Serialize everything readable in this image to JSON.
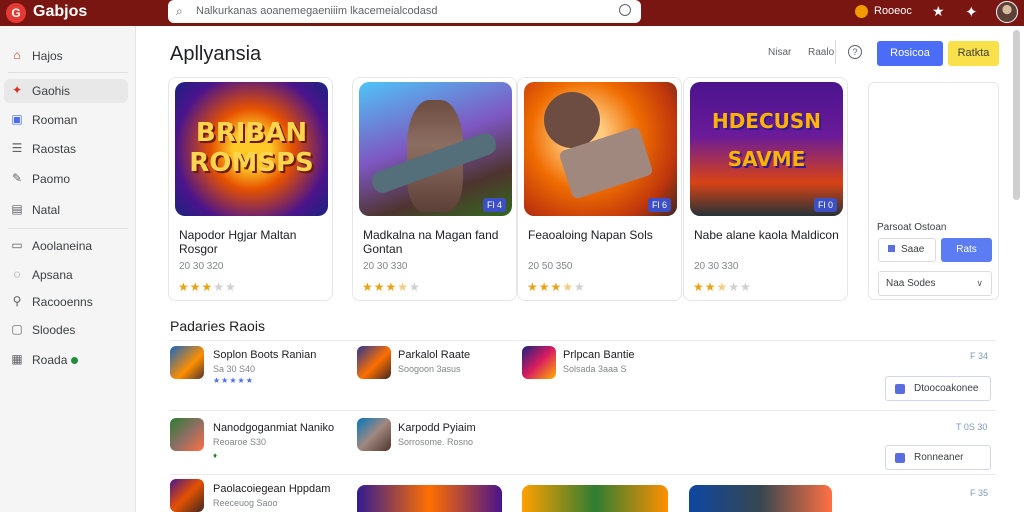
{
  "app": {
    "title": "Gabjos",
    "logo_glyph": "G"
  },
  "search": {
    "value": "Nalkurkanas aoanemegaeniiim lkacemeialcodasd"
  },
  "topbar": {
    "user_label": "Rooeoc"
  },
  "sidebar": {
    "items": [
      {
        "label": "Hajos",
        "icon": "home-icon",
        "glyph": "⌂"
      },
      {
        "label": "Gaohis",
        "icon": "games-icon",
        "glyph": "✦"
      },
      {
        "label": "Rooman",
        "icon": "apps-icon",
        "glyph": "▣"
      },
      {
        "label": "Raostas",
        "icon": "list-icon",
        "glyph": "☰"
      },
      {
        "label": "Paomo",
        "icon": "edit-icon",
        "glyph": "✎"
      },
      {
        "label": "Natal",
        "icon": "book-icon",
        "glyph": "▤"
      },
      {
        "label": "Aoolaneina",
        "icon": "library-icon",
        "glyph": "▭"
      },
      {
        "label": "Apsana",
        "icon": "chat-icon",
        "glyph": "◌"
      },
      {
        "label": "Racooenns",
        "icon": "lock-icon",
        "glyph": "⚲"
      },
      {
        "label": "Sloodes",
        "icon": "folder-icon",
        "glyph": "▢"
      },
      {
        "label": "Roada",
        "icon": "notice-icon",
        "glyph": "▦"
      }
    ]
  },
  "header": {
    "title": "Apllyansia",
    "links": [
      "Nisar",
      "Raalo"
    ],
    "help": "?",
    "primary_button": "Rosicoa",
    "secondary_button": "Ratkta"
  },
  "featured": [
    {
      "title": "Napodor Hgjar Maltan Rosgor",
      "meta": "20 30 320",
      "rating": 3,
      "art_text": "BRIBAN ROMSPS",
      "badge": ""
    },
    {
      "title": "Madkalna na Magan fand Gontan",
      "meta": "20 30 330",
      "rating": 3.5,
      "art_text": "",
      "badge": "Fl 4"
    },
    {
      "title": "Feaoaloing Napan Sols",
      "meta": "20 50 350",
      "rating": 3.5,
      "art_text": "",
      "badge": "Fl 6"
    },
    {
      "title": "Nabe alane kaola Maldicon",
      "meta": "20 30 330",
      "rating": 2.5,
      "art_text": "HDECUSN SAVME",
      "badge": "Fl 0"
    }
  ],
  "panel": {
    "label": "Parsoat Ostoan",
    "btn_secondary": "Saae",
    "btn_primary": "Rats",
    "select_value": "Naa Sodes"
  },
  "list": {
    "title": "Padaries Raois",
    "rows": [
      {
        "items": [
          {
            "name": "Soplon Boots Ranian",
            "sub": "Sa 30 S40",
            "stars": "★★★★★"
          },
          {
            "name": "Parkalol Raate",
            "sub": "Soogoon 3asus",
            "stars": ""
          },
          {
            "name": "Prlpcan Bantie",
            "sub": "Solsada 3aaa S",
            "stars": ""
          }
        ],
        "price": "F 34",
        "button": "Dtoocoakonee"
      },
      {
        "items": [
          {
            "name": "Nanodgoganmiat Naniko",
            "sub": "Reoaroe S30",
            "stars": "♦"
          },
          {
            "name": "Karpodd Pyiaim",
            "sub": "Sorrosome. Rosno",
            "stars": ""
          }
        ],
        "price": "T 0S 30",
        "button": "Ronneaner"
      },
      {
        "items": [
          {
            "name": "Paolacoiegean Hppdam",
            "sub": "Reeceuog Saoo",
            "stars": ""
          }
        ],
        "price": "F 35",
        "button": ""
      }
    ]
  },
  "colors": {
    "topbar": "#7a1611",
    "accent": "#4a6cf7",
    "yellow": "#f9e14b",
    "star": "#e8a317"
  }
}
